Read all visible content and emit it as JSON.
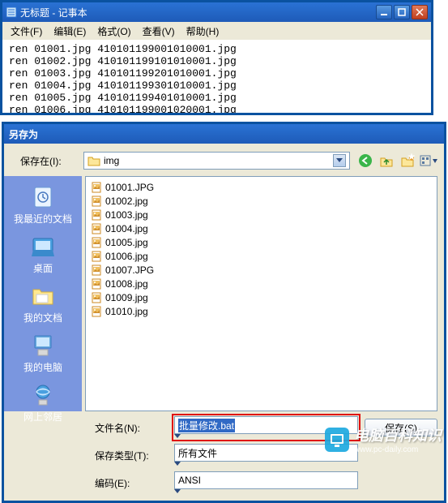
{
  "notepad": {
    "title": "无标题 - 记事本",
    "menus": [
      "文件(F)",
      "编辑(E)",
      "格式(O)",
      "查看(V)",
      "帮助(H)"
    ],
    "content": "ren 01001.jpg 410101199001010001.jpg\nren 01002.jpg 410101199101010001.jpg\nren 01003.jpg 410101199201010001.jpg\nren 01004.jpg 410101199301010001.jpg\nren 01005.jpg 410101199401010001.jpg\nren 01006.jpg 410101199001020001.jpg"
  },
  "savedlg": {
    "title": "另存为",
    "savein_label": "保存在(I):",
    "folder": "img",
    "sidebar": [
      {
        "label": "我最近的文档",
        "icon": "recent"
      },
      {
        "label": "桌面",
        "icon": "desktop"
      },
      {
        "label": "我的文档",
        "icon": "mydocs"
      },
      {
        "label": "我的电脑",
        "icon": "computer"
      },
      {
        "label": "网上邻居",
        "icon": "network"
      }
    ],
    "files": [
      "01001.JPG",
      "01002.jpg",
      "01003.jpg",
      "01004.jpg",
      "01005.jpg",
      "01006.jpg",
      "01007.JPG",
      "01008.jpg",
      "01009.jpg",
      "01010.jpg"
    ],
    "filename_label": "文件名(N):",
    "filename_value": "批量修改.bat",
    "filetype_label": "保存类型(T):",
    "filetype_value": "所有文件",
    "encoding_label": "编码(E):",
    "encoding_value": "ANSI",
    "save_button": "保存(S)"
  },
  "watermark": {
    "brand": "电脑百科知识",
    "url": "www.pc-daily.com"
  }
}
